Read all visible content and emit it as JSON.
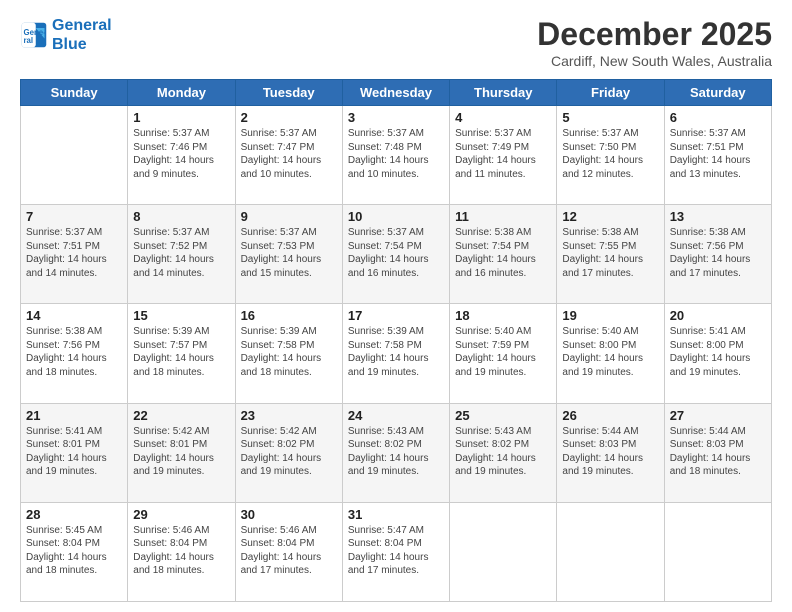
{
  "logo": {
    "line1": "General",
    "line2": "Blue"
  },
  "title": "December 2025",
  "subtitle": "Cardiff, New South Wales, Australia",
  "days_header": [
    "Sunday",
    "Monday",
    "Tuesday",
    "Wednesday",
    "Thursday",
    "Friday",
    "Saturday"
  ],
  "weeks": [
    [
      {
        "day": "",
        "info": ""
      },
      {
        "day": "1",
        "info": "Sunrise: 5:37 AM\nSunset: 7:46 PM\nDaylight: 14 hours\nand 9 minutes."
      },
      {
        "day": "2",
        "info": "Sunrise: 5:37 AM\nSunset: 7:47 PM\nDaylight: 14 hours\nand 10 minutes."
      },
      {
        "day": "3",
        "info": "Sunrise: 5:37 AM\nSunset: 7:48 PM\nDaylight: 14 hours\nand 10 minutes."
      },
      {
        "day": "4",
        "info": "Sunrise: 5:37 AM\nSunset: 7:49 PM\nDaylight: 14 hours\nand 11 minutes."
      },
      {
        "day": "5",
        "info": "Sunrise: 5:37 AM\nSunset: 7:50 PM\nDaylight: 14 hours\nand 12 minutes."
      },
      {
        "day": "6",
        "info": "Sunrise: 5:37 AM\nSunset: 7:51 PM\nDaylight: 14 hours\nand 13 minutes."
      }
    ],
    [
      {
        "day": "7",
        "info": "Sunrise: 5:37 AM\nSunset: 7:51 PM\nDaylight: 14 hours\nand 14 minutes."
      },
      {
        "day": "8",
        "info": "Sunrise: 5:37 AM\nSunset: 7:52 PM\nDaylight: 14 hours\nand 14 minutes."
      },
      {
        "day": "9",
        "info": "Sunrise: 5:37 AM\nSunset: 7:53 PM\nDaylight: 14 hours\nand 15 minutes."
      },
      {
        "day": "10",
        "info": "Sunrise: 5:37 AM\nSunset: 7:54 PM\nDaylight: 14 hours\nand 16 minutes."
      },
      {
        "day": "11",
        "info": "Sunrise: 5:38 AM\nSunset: 7:54 PM\nDaylight: 14 hours\nand 16 minutes."
      },
      {
        "day": "12",
        "info": "Sunrise: 5:38 AM\nSunset: 7:55 PM\nDaylight: 14 hours\nand 17 minutes."
      },
      {
        "day": "13",
        "info": "Sunrise: 5:38 AM\nSunset: 7:56 PM\nDaylight: 14 hours\nand 17 minutes."
      }
    ],
    [
      {
        "day": "14",
        "info": "Sunrise: 5:38 AM\nSunset: 7:56 PM\nDaylight: 14 hours\nand 18 minutes."
      },
      {
        "day": "15",
        "info": "Sunrise: 5:39 AM\nSunset: 7:57 PM\nDaylight: 14 hours\nand 18 minutes."
      },
      {
        "day": "16",
        "info": "Sunrise: 5:39 AM\nSunset: 7:58 PM\nDaylight: 14 hours\nand 18 minutes."
      },
      {
        "day": "17",
        "info": "Sunrise: 5:39 AM\nSunset: 7:58 PM\nDaylight: 14 hours\nand 19 minutes."
      },
      {
        "day": "18",
        "info": "Sunrise: 5:40 AM\nSunset: 7:59 PM\nDaylight: 14 hours\nand 19 minutes."
      },
      {
        "day": "19",
        "info": "Sunrise: 5:40 AM\nSunset: 8:00 PM\nDaylight: 14 hours\nand 19 minutes."
      },
      {
        "day": "20",
        "info": "Sunrise: 5:41 AM\nSunset: 8:00 PM\nDaylight: 14 hours\nand 19 minutes."
      }
    ],
    [
      {
        "day": "21",
        "info": "Sunrise: 5:41 AM\nSunset: 8:01 PM\nDaylight: 14 hours\nand 19 minutes."
      },
      {
        "day": "22",
        "info": "Sunrise: 5:42 AM\nSunset: 8:01 PM\nDaylight: 14 hours\nand 19 minutes."
      },
      {
        "day": "23",
        "info": "Sunrise: 5:42 AM\nSunset: 8:02 PM\nDaylight: 14 hours\nand 19 minutes."
      },
      {
        "day": "24",
        "info": "Sunrise: 5:43 AM\nSunset: 8:02 PM\nDaylight: 14 hours\nand 19 minutes."
      },
      {
        "day": "25",
        "info": "Sunrise: 5:43 AM\nSunset: 8:02 PM\nDaylight: 14 hours\nand 19 minutes."
      },
      {
        "day": "26",
        "info": "Sunrise: 5:44 AM\nSunset: 8:03 PM\nDaylight: 14 hours\nand 19 minutes."
      },
      {
        "day": "27",
        "info": "Sunrise: 5:44 AM\nSunset: 8:03 PM\nDaylight: 14 hours\nand 18 minutes."
      }
    ],
    [
      {
        "day": "28",
        "info": "Sunrise: 5:45 AM\nSunset: 8:04 PM\nDaylight: 14 hours\nand 18 minutes."
      },
      {
        "day": "29",
        "info": "Sunrise: 5:46 AM\nSunset: 8:04 PM\nDaylight: 14 hours\nand 18 minutes."
      },
      {
        "day": "30",
        "info": "Sunrise: 5:46 AM\nSunset: 8:04 PM\nDaylight: 14 hours\nand 17 minutes."
      },
      {
        "day": "31",
        "info": "Sunrise: 5:47 AM\nSunset: 8:04 PM\nDaylight: 14 hours\nand 17 minutes."
      },
      {
        "day": "",
        "info": ""
      },
      {
        "day": "",
        "info": ""
      },
      {
        "day": "",
        "info": ""
      }
    ]
  ]
}
